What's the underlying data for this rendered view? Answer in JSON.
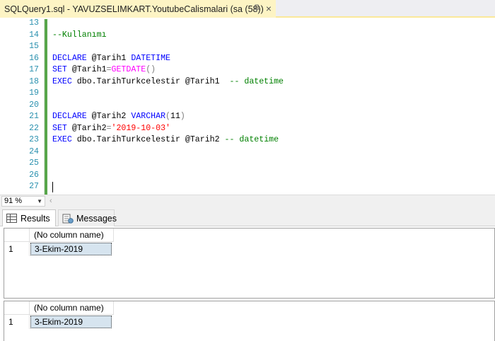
{
  "tab": {
    "title": "SQLQuery1.sql - YAVUZSELIMKART.YoutubeCalismalari (sa (58))",
    "pin_icon": "pin-icon",
    "close_icon": "close-icon"
  },
  "editor": {
    "lines": [
      {
        "n": "13"
      },
      {
        "n": "14"
      },
      {
        "n": "15"
      },
      {
        "n": "16"
      },
      {
        "n": "17"
      },
      {
        "n": "18"
      },
      {
        "n": "19"
      },
      {
        "n": "20"
      },
      {
        "n": "21"
      },
      {
        "n": "22"
      },
      {
        "n": "23"
      },
      {
        "n": "24"
      },
      {
        "n": "25"
      },
      {
        "n": "26"
      },
      {
        "n": "27"
      }
    ],
    "code": {
      "l14_comment": "--Kullanımı",
      "l16_kw": "DECLARE",
      "l16_var": " @Tarih1 ",
      "l16_type": "DATETIME",
      "l17_kw": "SET",
      "l17_var": " @Tarih1",
      "l17_eq": "=",
      "l17_fn": "GETDATE",
      "l17_paren": "()",
      "l18_kw": "EXEC",
      "l18_rest": " dbo.TarihTurkcelestir @Tarih1  ",
      "l18_comment": "-- datetime",
      "l21_kw": "DECLARE",
      "l21_var": " @Tarih2 ",
      "l21_type": "VARCHAR",
      "l21_open": "(",
      "l21_len": "11",
      "l21_close": ")",
      "l22_kw": "SET",
      "l22_var": " @Tarih2",
      "l22_eq": "=",
      "l22_str": "'2019-10-03'",
      "l23_kw": "EXEC",
      "l23_rest": " dbo.TarihTurkcelestir @Tarih2 ",
      "l23_comment": "-- datetime"
    }
  },
  "zoom": {
    "value": "91 %"
  },
  "results_tabs": {
    "results": "Results",
    "messages": "Messages"
  },
  "grids": [
    {
      "header": "(No column name)",
      "row_number": "1",
      "value": "3-Ekim-2019"
    },
    {
      "header": "(No column name)",
      "row_number": "1",
      "value": "3-Ekim-2019"
    }
  ],
  "colors": {
    "keyword": "#0000ff",
    "comment": "#008000",
    "function": "#ff00ff",
    "string": "#ff0000",
    "line_number": "#2b91af",
    "change_bar": "#57a64a",
    "active_tab": "#fdf4c4"
  }
}
